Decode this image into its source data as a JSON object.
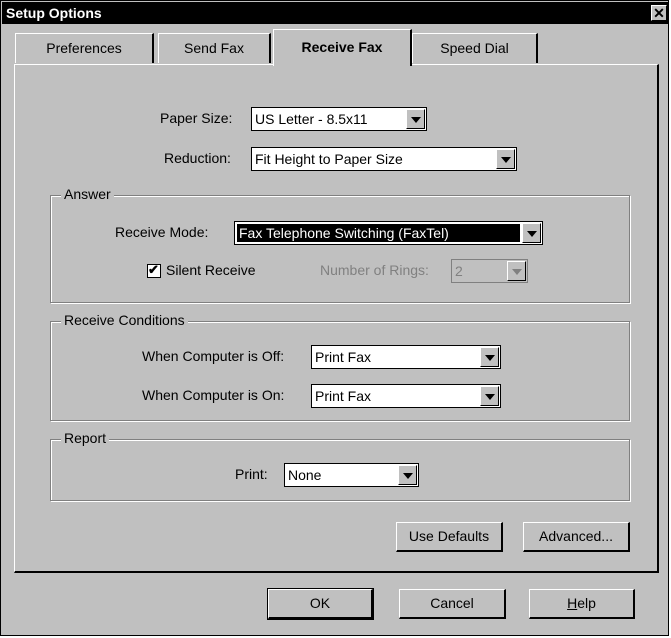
{
  "window": {
    "title": "Setup Options",
    "close_glyph": "✕"
  },
  "tabs": [
    {
      "label": "Preferences",
      "active": false
    },
    {
      "label": "Send Fax",
      "active": false
    },
    {
      "label": "Receive Fax",
      "active": true
    },
    {
      "label": "Speed Dial",
      "active": false
    }
  ],
  "receive_fax": {
    "paper_size": {
      "label": "Paper Size:",
      "value": "US Letter - 8.5x11"
    },
    "reduction": {
      "label": "Reduction:",
      "value": "Fit Height to Paper Size"
    },
    "answer": {
      "legend": "Answer",
      "receive_mode": {
        "label": "Receive Mode:",
        "value": "Fax Telephone Switching (FaxTel)"
      },
      "silent_receive": {
        "label": "Silent Receive",
        "checked": true
      },
      "number_of_rings": {
        "label": "Number of Rings:",
        "value": "2",
        "enabled": false
      }
    },
    "receive_conditions": {
      "legend": "Receive Conditions",
      "computer_off": {
        "label": "When Computer is Off:",
        "value": "Print Fax"
      },
      "computer_on": {
        "label": "When Computer is On:",
        "value": "Print Fax"
      }
    },
    "report": {
      "legend": "Report",
      "print": {
        "label": "Print:",
        "value": "None"
      }
    },
    "use_defaults_label": "Use Defaults",
    "advanced_label": "Advanced..."
  },
  "footer": {
    "ok_label": "OK",
    "cancel_label": "Cancel",
    "help_label_mnemonic": "H",
    "help_label_rest": "elp"
  },
  "icons": {
    "checkmark": "✔"
  },
  "colors": {
    "face": "#c0c0c0",
    "titlebar": "#000000",
    "selection": "#000000"
  }
}
